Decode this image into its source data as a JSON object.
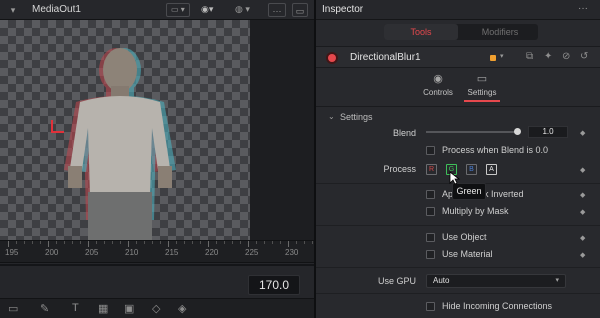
{
  "viewer": {
    "title": "MediaOut1",
    "ruler_ticks": [
      "195",
      "200",
      "205",
      "210",
      "215",
      "220",
      "225",
      "230"
    ],
    "current_frame": "170.0"
  },
  "inspector": {
    "title": "Inspector",
    "tabs": [
      "Tools",
      "Modifiers"
    ],
    "active_tab": "Tools",
    "node_name": "DirectionalBlur1",
    "node_color": "#f0a030",
    "sub_tabs": [
      "Controls",
      "Settings"
    ],
    "active_sub_tab": "Settings",
    "section": "Settings",
    "blend_label": "Blend",
    "blend_value": "1.0",
    "blend_fraction": 1.0,
    "process_when_blend_label": "Process when Blend is 0.0",
    "process_label": "Process",
    "process_channels": [
      "R",
      "G",
      "B",
      "A"
    ],
    "apply_mask_inverted_label": "Apply Mask Inverted",
    "multiply_by_mask_label": "Multiply by Mask",
    "use_object_label": "Use Object",
    "use_material_label": "Use Material",
    "use_gpu_label": "Use GPU",
    "use_gpu_value": "Auto",
    "hide_incoming_label": "Hide Incoming Connections",
    "tooltip": "Green"
  },
  "colors": {
    "accent": "#e5484d",
    "red_channel": "#c84a4a",
    "green_channel": "#3fbf5a",
    "blue_channel": "#4a7fd4"
  }
}
